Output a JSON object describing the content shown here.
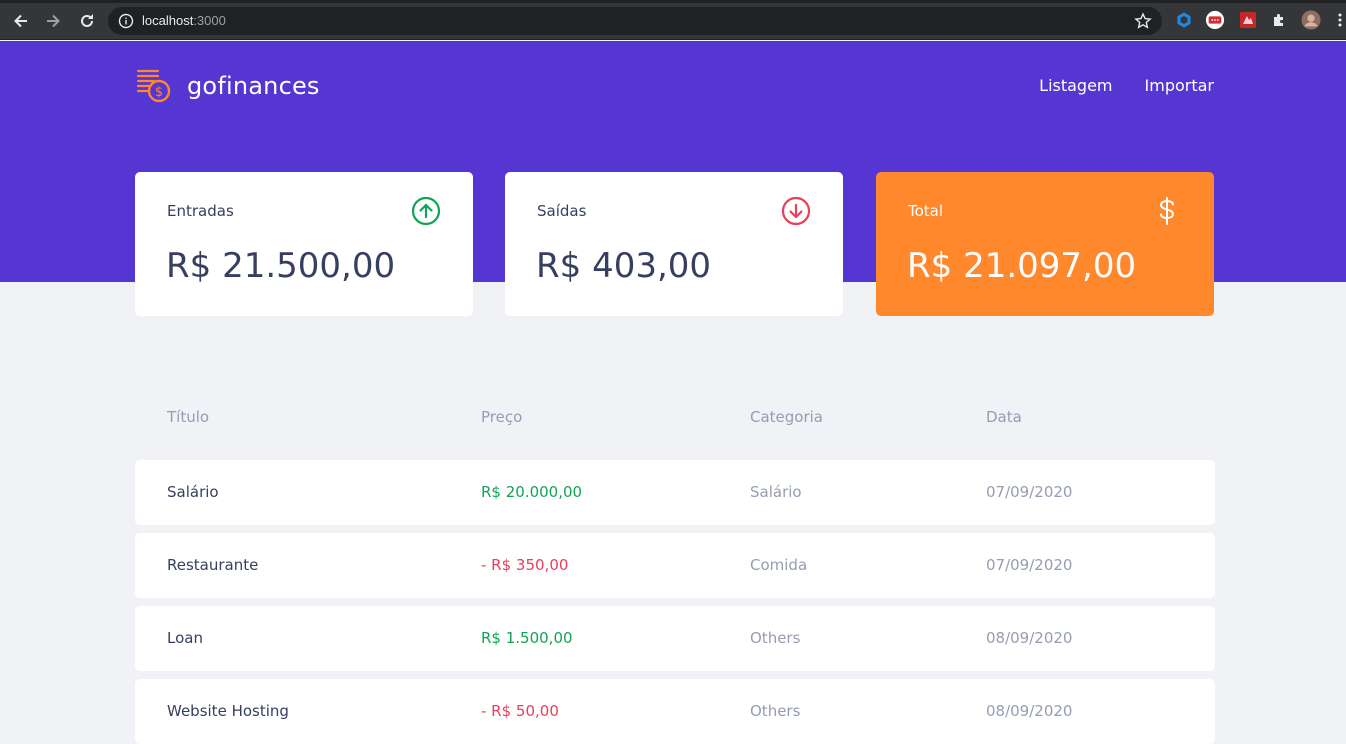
{
  "browser": {
    "url_host": "localhost",
    "url_port": ":3000"
  },
  "app": {
    "name": "gofinances",
    "nav": [
      {
        "label": "Listagem"
      },
      {
        "label": "Importar"
      }
    ]
  },
  "cards": {
    "income": {
      "label": "Entradas",
      "value": "R$ 21.500,00",
      "icon": "arrow-up-circle-icon",
      "color": "#12A454"
    },
    "outcome": {
      "label": "Saídas",
      "value": "R$ 403,00",
      "icon": "arrow-down-circle-icon",
      "color": "#E83F5B"
    },
    "total": {
      "label": "Total",
      "value": "R$ 21.097,00",
      "icon": "dollar-sign-icon",
      "color": "#FF872C"
    }
  },
  "table": {
    "headers": [
      "Título",
      "Preço",
      "Categoria",
      "Data"
    ],
    "rows": [
      {
        "title": "Salário",
        "price": "R$ 20.000,00",
        "type": "income",
        "category": "Salário",
        "date": "07/09/2020"
      },
      {
        "title": "Restaurante",
        "price": "- R$ 350,00",
        "type": "outcome",
        "category": "Comida",
        "date": "07/09/2020"
      },
      {
        "title": "Loan",
        "price": "R$ 1.500,00",
        "type": "income",
        "category": "Others",
        "date": "08/09/2020"
      },
      {
        "title": "Website Hosting",
        "price": "- R$ 50,00",
        "type": "outcome",
        "category": "Others",
        "date": "08/09/2020"
      }
    ]
  },
  "colors": {
    "header_bg": "#5636D3",
    "page_bg": "#F0F2F5",
    "text": "#363F5F",
    "muted": "#969CB3"
  }
}
